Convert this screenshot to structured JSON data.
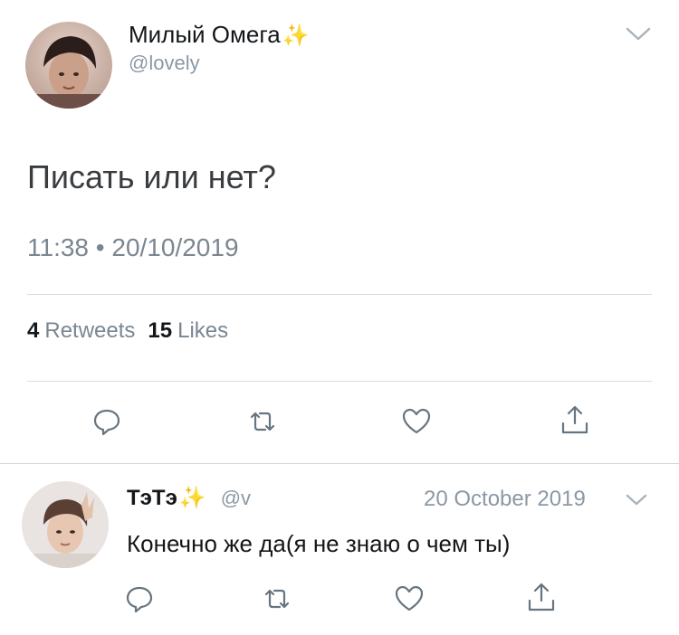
{
  "main_tweet": {
    "display_name": "Милый Омега",
    "name_emoji": "✨",
    "handle": "@lovely",
    "text": "Писать или нет?",
    "time": "11:38",
    "separator": "•",
    "date": "20/10/2019",
    "retweets_count": "4",
    "retweets_label": "Retweets",
    "likes_count": "15",
    "likes_label": "Likes",
    "actions": [
      "reply-icon",
      "retweet-icon",
      "like-icon",
      "share-icon"
    ]
  },
  "reply_tweet": {
    "display_name": "ТэТэ",
    "name_emoji": "✨",
    "handle": "@v",
    "date": "20 October 2019",
    "text": "Конечно же да(я не знаю о чем ты)",
    "actions": [
      "reply-icon",
      "retweet-icon",
      "like-icon",
      "share-icon"
    ]
  },
  "colors": {
    "text_primary": "#14171a",
    "text_secondary": "#8b98a5",
    "divider": "#d8dde2",
    "sparkle": "#f4c84d"
  }
}
